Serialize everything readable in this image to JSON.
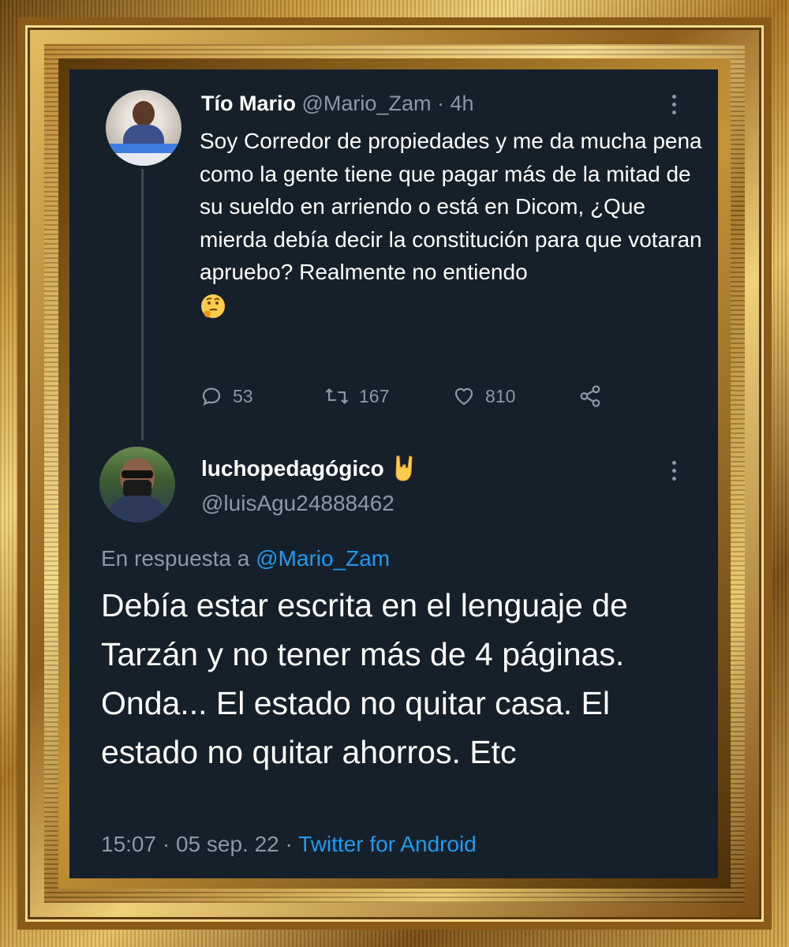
{
  "tweet": {
    "author_name": "Tío Mario",
    "handle": "@Mario_Zam",
    "separator": "·",
    "age": "4h",
    "text": "Soy Corredor de propiedades y me da mucha pena como la gente tiene que pagar más de la mitad de su sueldo en arriendo o está en Dicom, ¿Que mierda debía decir la constitución para que votaran apruebo? Realmente no entiendo",
    "emoji": "thinking-face",
    "replies": "53",
    "retweets": "167",
    "likes": "810"
  },
  "reply": {
    "author_name": "luchopedagógico",
    "name_emoji": "sign-of-the-horns",
    "handle": "@luisAgu24888462",
    "replying_prefix": "En respuesta a",
    "replying_to": "@Mario_Zam",
    "text": "Debía estar escrita en el lenguaje de Tarzán y no tener más de 4 páginas. Onda... El estado no quitar casa. El estado no quitar ahorros. Etc",
    "time": "15:07",
    "sep1": "·",
    "date": "05 sep. 22",
    "sep2": "·",
    "source": "Twitter for Android"
  },
  "colors": {
    "background": "#15202b",
    "text": "#ffffff",
    "secondary": "#8b98a5",
    "link": "#1d9bf0"
  },
  "icons": [
    "reply-icon",
    "retweet-icon",
    "like-icon",
    "share-icon",
    "more-icon"
  ]
}
